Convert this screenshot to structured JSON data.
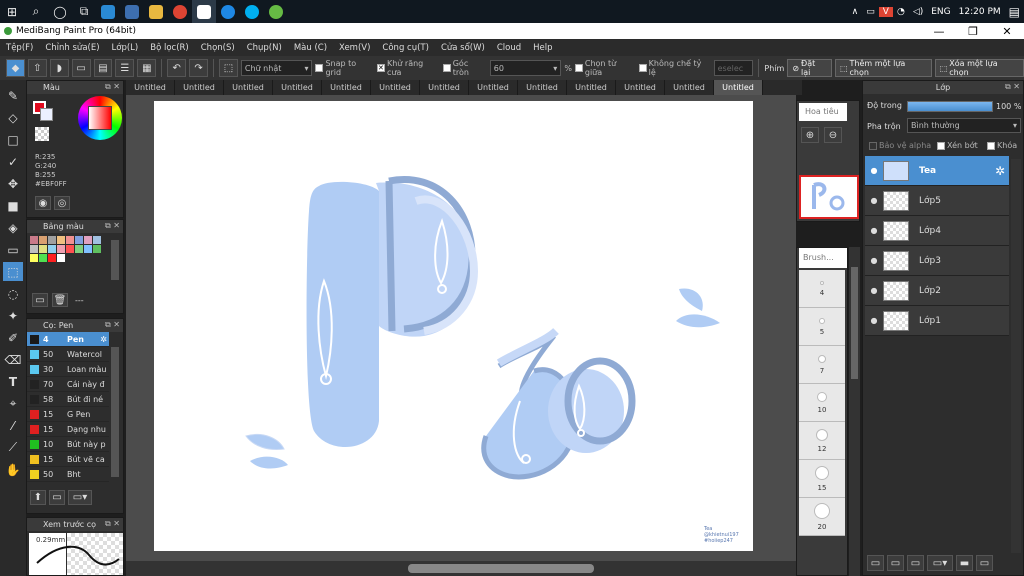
{
  "app": {
    "title": "MediBang Paint Pro (64bit)"
  },
  "taskbar": {
    "lang": "ENG",
    "time": "12:20 PM"
  },
  "menu": [
    "Tệp(F)",
    "Chỉnh sửa(E)",
    "Lớp(L)",
    "Bộ lọc(R)",
    "Chọn(S)",
    "Chụp(N)",
    "Màu (C)",
    "Xem(V)",
    "Công cụ(T)",
    "Cửa sổ(W)",
    "Cloud",
    "Help"
  ],
  "toolbar": {
    "shape": "Chữ nhật",
    "snap": "Snap to grid",
    "antialias": "Khử răng cưa",
    "round": "Góc tròn",
    "round_value": "60",
    "percent": "%",
    "center": "Chọn từ giữa",
    "fixed": "Không chế tỷ lệ",
    "field": "eselec",
    "key_label": "Phím",
    "reset": "Đặt lại",
    "add_sel": "Thêm một lựa chọn",
    "del_sel": "Xóa một lựa chọn"
  },
  "color_panel": {
    "title": "Màu",
    "r": "R:235",
    "g": "G:240",
    "b": "B:255",
    "hex": "#EBF0FF",
    "main": "#e00a1e",
    "sub": "#ebf0ff"
  },
  "palette": {
    "title": "Bảng màu",
    "footer": "---",
    "colors": [
      "#c97a8a",
      "#d9a070",
      "#a0a0a0",
      "#f0c080",
      "#f09090",
      "#80a0e0",
      "#e0a0c0",
      "#a0c0e0",
      "#c0c0c0",
      "#e0e080",
      "#90d0f0",
      "#f0a0b0",
      "#ff5050",
      "#80d080",
      "#80c0ff",
      "#60c060",
      "#ffff60",
      "#50e050",
      "#ff2020",
      "#ffffff"
    ]
  },
  "brush_panel": {
    "title": "Cọ: Pen",
    "items": [
      {
        "size": "4",
        "name": "Pen",
        "color": "#1a1a1a"
      },
      {
        "size": "50",
        "name": "Watercol",
        "color": "#5bc8f0"
      },
      {
        "size": "30",
        "name": "Loan màu",
        "color": "#5bc8f0"
      },
      {
        "size": "70",
        "name": "Cái này đ",
        "color": "#222222"
      },
      {
        "size": "58",
        "name": "Bút đi né",
        "color": "#222222"
      },
      {
        "size": "15",
        "name": "G Pen",
        "color": "#e02020"
      },
      {
        "size": "15",
        "name": "Dạng nhu",
        "color": "#e02020"
      },
      {
        "size": "10",
        "name": "Bút này p",
        "color": "#20c020"
      },
      {
        "size": "15",
        "name": "Bút vẽ ca",
        "color": "#f0c020"
      },
      {
        "size": "50",
        "name": "Bht",
        "color": "#f0d020"
      }
    ]
  },
  "preview": {
    "title": "Xem trước cọ",
    "size": "0.29mm"
  },
  "tabs": [
    "Untitled",
    "Untitled",
    "Untitled",
    "Untitled",
    "Untitled",
    "Untitled",
    "Untitled",
    "Untitled",
    "Untitled",
    "Untitled",
    "Untitled",
    "Untitled",
    "Untitled"
  ],
  "navigator": {
    "title": "Hoa tiêu"
  },
  "brush_sizes": {
    "title": "Brush...",
    "sizes": [
      "4",
      "5",
      "7",
      "10",
      "12",
      "15",
      "20"
    ]
  },
  "canvas": {
    "signature": [
      "Tea",
      "@khietnui197",
      "#hoiiep247"
    ]
  },
  "layers": {
    "title": "Lớp",
    "opacity_label": "Độ trong",
    "opacity": "100 %",
    "blend_label": "Pha trộn",
    "blend": "Bình thường",
    "protect": "Bảo vệ alpha",
    "clip": "Xén bớt",
    "lock": "Khóa",
    "items": [
      "Tea",
      "Lớp5",
      "Lớp4",
      "Lớp3",
      "Lớp2",
      "Lớp1"
    ]
  }
}
